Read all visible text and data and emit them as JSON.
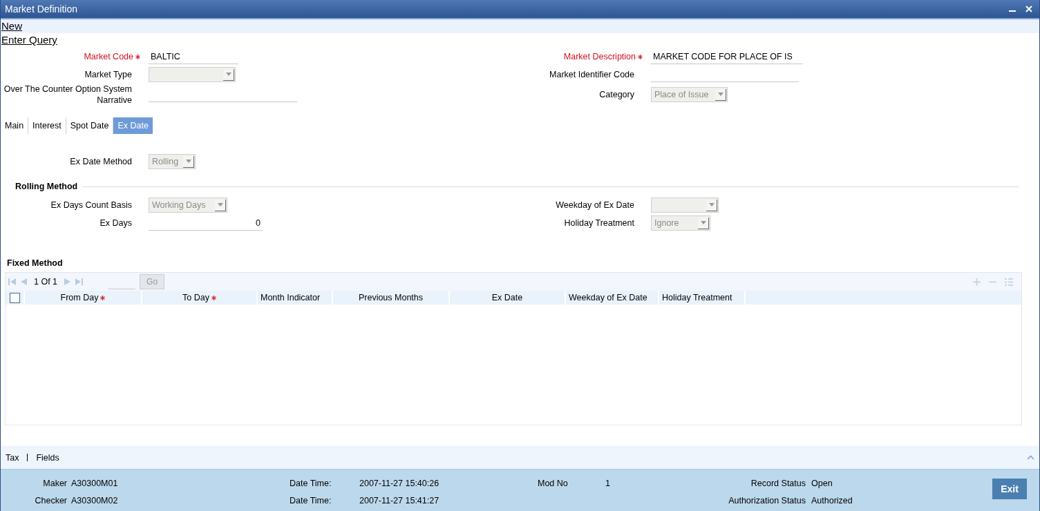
{
  "window": {
    "title": "Market Definition"
  },
  "actions": [
    {
      "label": "New"
    },
    {
      "label": "Enter Query"
    }
  ],
  "header_rows": [
    {
      "left": {
        "label": "Market Code",
        "required": true,
        "kind": "text",
        "value": "BALTIC"
      },
      "right": {
        "label": "Market Description",
        "required": true,
        "kind": "text",
        "value": "MARKET CODE FOR PLACE OF IS"
      }
    },
    {
      "left": {
        "label": "Market Type",
        "required": false,
        "kind": "select"
      },
      "right": {
        "label": "Market Identifier Code",
        "required": false,
        "kind": "text"
      }
    },
    {
      "left": {
        "label": "Over The Counter Option System Narrative",
        "required": false,
        "kind": "text"
      },
      "right": {
        "label": "Category",
        "required": false,
        "kind": "select",
        "value": "Place of Issue"
      }
    }
  ],
  "tabs": [
    {
      "label": "Main",
      "selected": false
    },
    {
      "label": "Interest",
      "selected": false
    },
    {
      "label": "Spot Date",
      "selected": false
    },
    {
      "label": "Ex Date",
      "selected": true
    }
  ],
  "ex_date": {
    "method": {
      "label": "Ex Date Method",
      "required": false,
      "kind": "select",
      "value": "Rolling"
    },
    "rolling_method": {
      "title": "Rolling Method",
      "rows": [
        {
          "left": {
            "label": "Ex Days Count Basis",
            "required": false,
            "kind": "select",
            "value": "Working Days"
          },
          "right": {
            "label": "Weekday of Ex Date",
            "required": false,
            "kind": "select"
          }
        },
        {
          "left": {
            "label": "Ex Days",
            "required": false,
            "kind": "number",
            "value": "0"
          },
          "right": {
            "label": "Holiday Treatment",
            "required": false,
            "kind": "select",
            "value": "Ignore"
          }
        }
      ]
    },
    "fixed_method": {
      "title": "Fixed Method",
      "pager": "1 Of 1",
      "go_label": "Go",
      "select_all_checked": false,
      "columns": [
        {
          "label": "From Day",
          "required": true
        },
        {
          "label": "To Day",
          "required": true
        },
        {
          "label": "Month Indicator",
          "required": false
        },
        {
          "label": "Previous Months",
          "required": false
        },
        {
          "label": "Ex Date",
          "required": false
        },
        {
          "label": "Weekday of Ex Date",
          "required": false
        },
        {
          "label": "Holiday Treatment",
          "required": false
        }
      ]
    }
  },
  "footer_links": [
    {
      "label": "Tax"
    },
    {
      "label": "Fields"
    }
  ],
  "audit_columns": [
    [
      {
        "label": "Maker",
        "value": "A30300M01"
      },
      {
        "label": "Checker",
        "value": "A30300M02"
      }
    ],
    [
      {
        "label": "Date Time:",
        "value": "2007-11-27 15:40:26"
      },
      {
        "label": "Date Time:",
        "value": "2007-11-27 15:41:27"
      }
    ],
    [
      {
        "label": "Mod No",
        "value": "1"
      }
    ],
    [
      {
        "label": "Record Status",
        "value": "Open"
      },
      {
        "label": "Authorization Status",
        "value": "Authorized"
      }
    ]
  ],
  "exit_button": {
    "label": "Exit"
  }
}
